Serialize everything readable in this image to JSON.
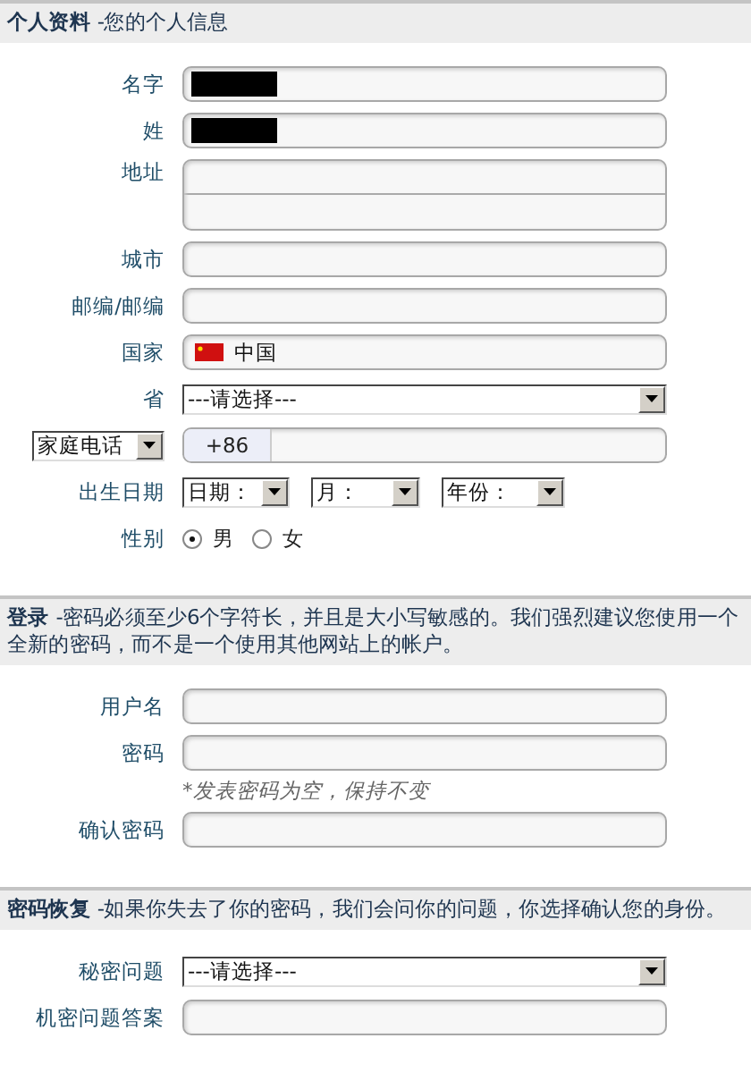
{
  "sections": [
    {
      "title": "个人资料",
      "description": "-您的个人信息",
      "rows": [
        {
          "kind": "text",
          "label": "名字",
          "redacted": true
        },
        {
          "kind": "text",
          "label": "姓",
          "redacted": true
        },
        {
          "kind": "textarea",
          "label": "地址"
        },
        {
          "kind": "text",
          "label": "城市"
        },
        {
          "kind": "text",
          "label": "邮编/邮编"
        },
        {
          "kind": "country",
          "label": "国家",
          "value": "中国"
        },
        {
          "kind": "select",
          "label": "省",
          "value": "---请选择---"
        },
        {
          "kind": "phone",
          "label": "家庭电话",
          "prefix": "+86"
        },
        {
          "kind": "date",
          "label": "出生日期",
          "selects": [
            "日期：",
            "月：",
            "年份："
          ]
        },
        {
          "kind": "radio",
          "label": "性别",
          "options": [
            {
              "label": "男",
              "selected": true
            },
            {
              "label": "女",
              "selected": false
            }
          ]
        }
      ]
    },
    {
      "title": "登录",
      "description": "-密码必须至少6个字符长，并且是大小写敏感的。我们强烈建议您使用一个全新的密码，而不是一个使用其他网站上的帐户。",
      "rows": [
        {
          "kind": "text",
          "label": "用户名"
        },
        {
          "kind": "text",
          "label": "密码"
        },
        {
          "kind": "hint",
          "text": "*发表密码为空，保持不变"
        },
        {
          "kind": "text",
          "label": "确认密码"
        }
      ]
    },
    {
      "title": "密码恢复",
      "description": "-如果你失去了你的密码，我们会问你的问题，你选择确认您的身份。",
      "rows": [
        {
          "kind": "select",
          "label": "秘密问题",
          "value": "---请选择---"
        },
        {
          "kind": "text",
          "label": "机密问题答案"
        }
      ]
    }
  ]
}
